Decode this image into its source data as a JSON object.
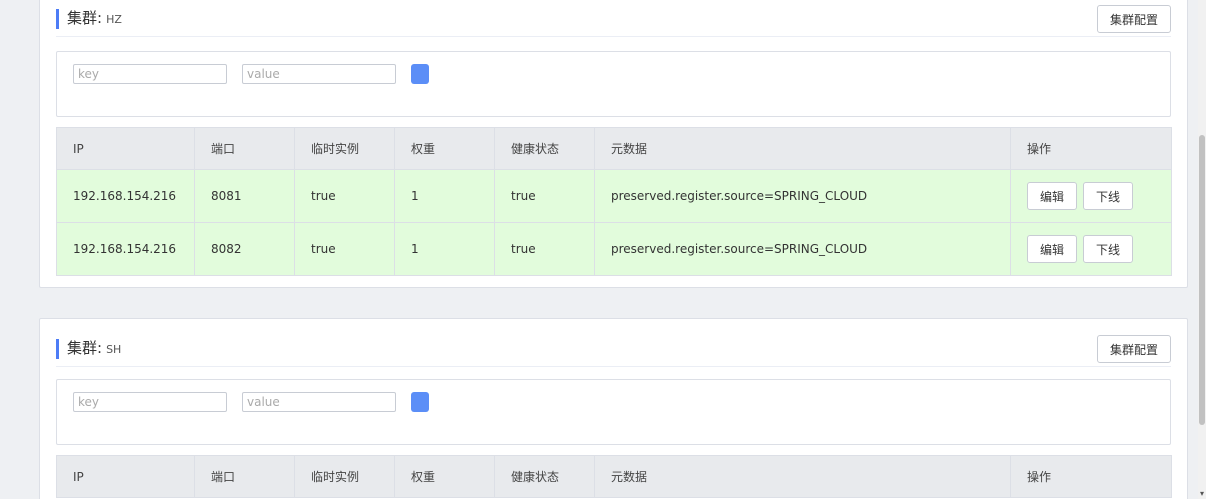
{
  "clusters": [
    {
      "label": "集群:",
      "name": "HZ",
      "config_button": "集群配置",
      "filter": {
        "key_placeholder": "key",
        "value_placeholder": "value"
      },
      "columns": [
        "IP",
        "端口",
        "临时实例",
        "权重",
        "健康状态",
        "元数据",
        "操作"
      ],
      "rows": [
        {
          "ip": "192.168.154.216",
          "port": "8081",
          "ephemeral": "true",
          "weight": "1",
          "healthy": "true",
          "metadata": "preserved.register.source=SPRING_CLOUD",
          "edit": "编辑",
          "offline": "下线"
        },
        {
          "ip": "192.168.154.216",
          "port": "8082",
          "ephemeral": "true",
          "weight": "1",
          "healthy": "true",
          "metadata": "preserved.register.source=SPRING_CLOUD",
          "edit": "编辑",
          "offline": "下线"
        }
      ]
    },
    {
      "label": "集群:",
      "name": "SH",
      "config_button": "集群配置",
      "filter": {
        "key_placeholder": "key",
        "value_placeholder": "value"
      },
      "columns": [
        "IP",
        "端口",
        "临时实例",
        "权重",
        "健康状态",
        "元数据",
        "操作"
      ],
      "rows": []
    }
  ],
  "colors": {
    "accent": "#4d7cf6",
    "search_button": "#5b8ef7",
    "row_bg": "#e2fcdc",
    "header_bg": "#e8eaed"
  },
  "icons": {
    "search": "search-icon"
  }
}
